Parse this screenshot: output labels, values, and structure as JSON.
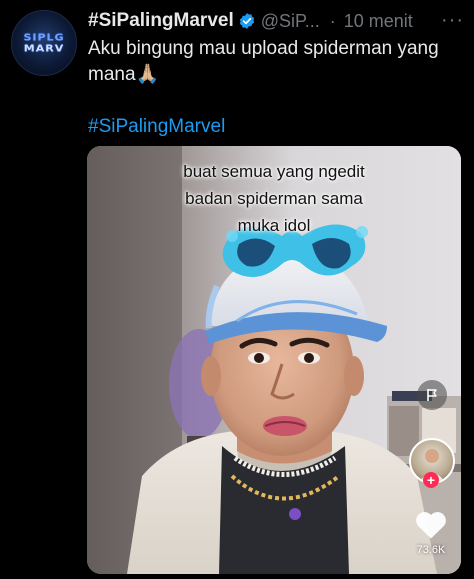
{
  "tweet": {
    "avatar_text_line1": "SIPLG",
    "avatar_text_line2": "MARV",
    "display_name": "#SiPalingMarvel",
    "handle": "@SiP...",
    "separator": "·",
    "timestamp": "10 menit",
    "more_icon": "more-dots",
    "text": "Aku bingung mau upload spiderman yang mana🙏🏼",
    "hashtag": "#SiPalingMarvel",
    "accent_color": "#1d9bf0"
  },
  "video": {
    "caption_lines": [
      "buat semua yang ngedit",
      "badan spiderman sama",
      "muka idol"
    ],
    "like_count": "73.6K",
    "icons": [
      "flag-icon",
      "creator-avatar",
      "follow-plus-icon",
      "heart-icon"
    ]
  }
}
